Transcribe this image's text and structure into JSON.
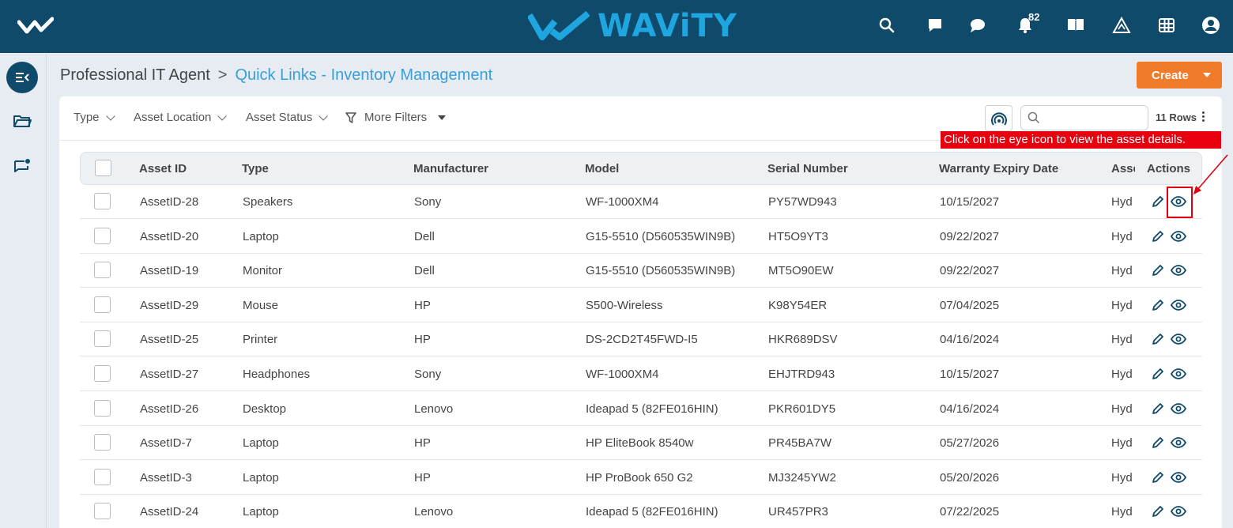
{
  "header": {
    "logo_text": "WAViTY",
    "notification_count": "82",
    "brand_color": "#0f4a6b",
    "accent_color": "#1fa6e0",
    "icons": [
      "search-icon",
      "announcement-icon",
      "chat-icon",
      "bell-icon",
      "knowledge-book-icon",
      "alert-triangle-icon",
      "grid-apps-icon",
      "user-avatar-icon"
    ]
  },
  "sidebar": {
    "items": [
      {
        "icon": "collapse-menu-icon",
        "active": true
      },
      {
        "icon": "folder-icon",
        "active": false
      },
      {
        "icon": "message-notification-icon",
        "active": false
      }
    ]
  },
  "breadcrumb": {
    "root": "Professional IT Agent",
    "separator": ">",
    "current": "Quick Links - Inventory Management"
  },
  "toolbar": {
    "create_label": "Create",
    "create_color": "#f07b2a"
  },
  "filters": {
    "type": "Type",
    "asset_location": "Asset Location",
    "asset_status": "Asset Status",
    "more_filters": "More Filters",
    "search_placeholder": "",
    "rows_count": "11 Rows"
  },
  "table": {
    "columns": {
      "asset_id": "Asset ID",
      "type": "Type",
      "manufacturer": "Manufacturer",
      "model": "Model",
      "serial": "Serial Number",
      "warranty": "Warranty Expiry Date",
      "location": "Asse",
      "actions": "Actions"
    },
    "rows": [
      {
        "id": "AssetID-28",
        "type": "Speakers",
        "mfr": "Sony",
        "model": "WF-1000XM4",
        "serial": "PY57WD943",
        "warranty": "10/15/2027",
        "loc": "Hyd"
      },
      {
        "id": "AssetID-20",
        "type": "Laptop",
        "mfr": "Dell",
        "model": "G15-5510 (D560535WIN9B)",
        "serial": "HT5O9YT3",
        "warranty": "09/22/2027",
        "loc": "Hyd"
      },
      {
        "id": "AssetID-19",
        "type": "Monitor",
        "mfr": "Dell",
        "model": "G15-5510 (D560535WIN9B)",
        "serial": "MT5O90EW",
        "warranty": "09/22/2027",
        "loc": "Hyd"
      },
      {
        "id": "AssetID-29",
        "type": "Mouse",
        "mfr": "HP",
        "model": "S500-Wireless",
        "serial": "K98Y54ER",
        "warranty": "07/04/2025",
        "loc": "Hyd"
      },
      {
        "id": "AssetID-25",
        "type": "Printer",
        "mfr": "HP",
        "model": "DS-2CD2T45FWD-I5",
        "serial": "HKR689DSV",
        "warranty": "04/16/2024",
        "loc": "Hyd"
      },
      {
        "id": "AssetID-27",
        "type": "Headphones",
        "mfr": "Sony",
        "model": "WF-1000XM4",
        "serial": "EHJTRD943",
        "warranty": "10/15/2027",
        "loc": "Hyd"
      },
      {
        "id": "AssetID-26",
        "type": "Desktop",
        "mfr": "Lenovo",
        "model": "Ideapad 5 (82FE016HIN)",
        "serial": "PKR601DY5",
        "warranty": "04/16/2024",
        "loc": "Hyd"
      },
      {
        "id": "AssetID-7",
        "type": "Laptop",
        "mfr": "HP",
        "model": "HP EliteBook 8540w",
        "serial": "PR45BA7W",
        "warranty": "05/27/2026",
        "loc": "Hyd"
      },
      {
        "id": "AssetID-3",
        "type": "Laptop",
        "mfr": "HP",
        "model": "HP ProBook 650 G2",
        "serial": "MJ3245YW2",
        "warranty": "05/20/2026",
        "loc": "Hyd"
      },
      {
        "id": "AssetID-24",
        "type": "Laptop",
        "mfr": "Lenovo",
        "model": "Ideapad 5 (82FE016HIN)",
        "serial": "UR457PR3",
        "warranty": "07/22/2025",
        "loc": "Hyd"
      }
    ]
  },
  "annotation": {
    "text": "Click on the eye icon to view the asset details.",
    "color": "#e8000f"
  }
}
